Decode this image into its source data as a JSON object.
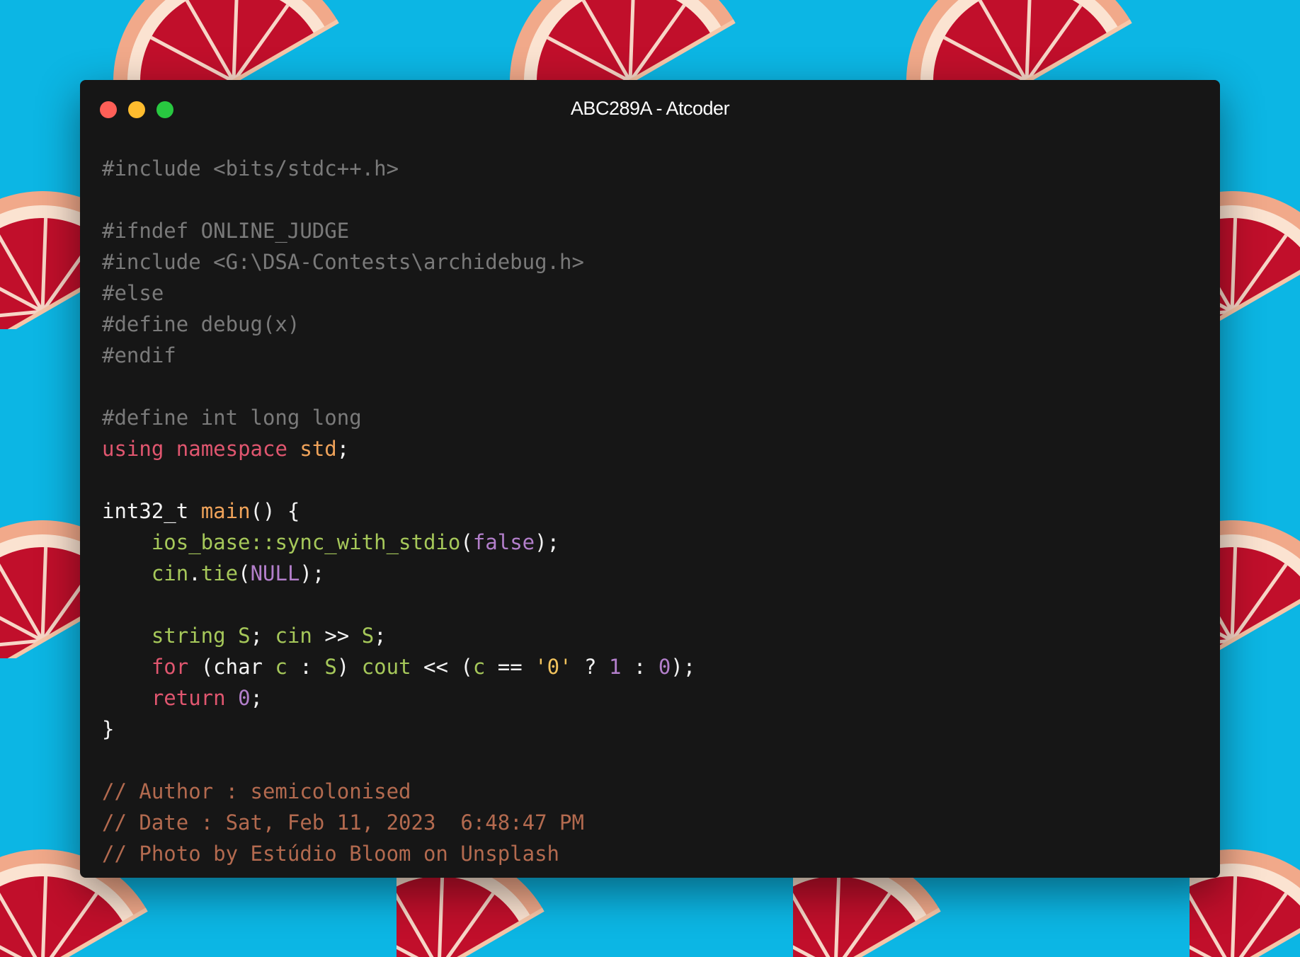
{
  "window": {
    "title": "ABC289A - Atcoder",
    "controls": [
      "close",
      "minimize",
      "zoom"
    ]
  },
  "colors": {
    "background": "#0cb6e4",
    "window": "#161616",
    "close": "#ff5f57",
    "minimize": "#febc2e",
    "zoom": "#28c840"
  },
  "code": {
    "lines": [
      [
        {
          "t": "#include <bits/stdc++.h>",
          "c": "pre"
        }
      ],
      [],
      [
        {
          "t": "#ifndef ONLINE_JUDGE",
          "c": "pre"
        }
      ],
      [
        {
          "t": "#include <G:\\DSA-Contests\\archidebug.h>",
          "c": "pre"
        }
      ],
      [
        {
          "t": "#else",
          "c": "pre"
        }
      ],
      [
        {
          "t": "#define debug(x)",
          "c": "pre"
        }
      ],
      [
        {
          "t": "#endif",
          "c": "pre"
        }
      ],
      [],
      [
        {
          "t": "#define int long long",
          "c": "pre"
        }
      ],
      [
        {
          "t": "using",
          "c": "kw"
        },
        {
          "t": " ",
          "c": "wh"
        },
        {
          "t": "namespace",
          "c": "kw"
        },
        {
          "t": " ",
          "c": "wh"
        },
        {
          "t": "std",
          "c": "fn"
        },
        {
          "t": ";",
          "c": "wh"
        }
      ],
      [],
      [
        {
          "t": "int32_t ",
          "c": "wh"
        },
        {
          "t": "main",
          "c": "fn"
        },
        {
          "t": "() {",
          "c": "wh"
        }
      ],
      [
        {
          "t": "    ",
          "c": "wh"
        },
        {
          "t": "ios_base::sync_with_stdio",
          "c": "gr"
        },
        {
          "t": "(",
          "c": "wh"
        },
        {
          "t": "false",
          "c": "pu"
        },
        {
          "t": ");",
          "c": "wh"
        }
      ],
      [
        {
          "t": "    ",
          "c": "wh"
        },
        {
          "t": "cin",
          "c": "gr"
        },
        {
          "t": ".",
          "c": "wh"
        },
        {
          "t": "tie",
          "c": "gr"
        },
        {
          "t": "(",
          "c": "wh"
        },
        {
          "t": "NULL",
          "c": "pu"
        },
        {
          "t": ");",
          "c": "wh"
        }
      ],
      [],
      [
        {
          "t": "    ",
          "c": "wh"
        },
        {
          "t": "string",
          "c": "gr"
        },
        {
          "t": " ",
          "c": "wh"
        },
        {
          "t": "S",
          "c": "gr"
        },
        {
          "t": "; ",
          "c": "wh"
        },
        {
          "t": "cin",
          "c": "gr"
        },
        {
          "t": " >> ",
          "c": "wh"
        },
        {
          "t": "S",
          "c": "gr"
        },
        {
          "t": ";",
          "c": "wh"
        }
      ],
      [
        {
          "t": "    ",
          "c": "wh"
        },
        {
          "t": "for",
          "c": "kw"
        },
        {
          "t": " (char ",
          "c": "wh"
        },
        {
          "t": "c",
          "c": "gr"
        },
        {
          "t": " : ",
          "c": "wh"
        },
        {
          "t": "S",
          "c": "gr"
        },
        {
          "t": ") ",
          "c": "wh"
        },
        {
          "t": "cout",
          "c": "gr"
        },
        {
          "t": " << (",
          "c": "wh"
        },
        {
          "t": "c",
          "c": "gr"
        },
        {
          "t": " == ",
          "c": "wh"
        },
        {
          "t": "'0'",
          "c": "str"
        },
        {
          "t": " ? ",
          "c": "wh"
        },
        {
          "t": "1",
          "c": "pu"
        },
        {
          "t": " : ",
          "c": "wh"
        },
        {
          "t": "0",
          "c": "pu"
        },
        {
          "t": ");",
          "c": "wh"
        }
      ],
      [
        {
          "t": "    ",
          "c": "wh"
        },
        {
          "t": "return",
          "c": "kw"
        },
        {
          "t": " ",
          "c": "wh"
        },
        {
          "t": "0",
          "c": "pu"
        },
        {
          "t": ";",
          "c": "wh"
        }
      ],
      [
        {
          "t": "}",
          "c": "wh"
        }
      ],
      [],
      [
        {
          "t": "// Author : semicolonised",
          "c": "cm"
        }
      ],
      [
        {
          "t": "// Date : Sat, Feb 11, 2023  6:48:47 PM",
          "c": "cm"
        }
      ],
      [
        {
          "t": "// Photo by Estúdio Bloom on Unsplash",
          "c": "cm"
        }
      ]
    ]
  }
}
